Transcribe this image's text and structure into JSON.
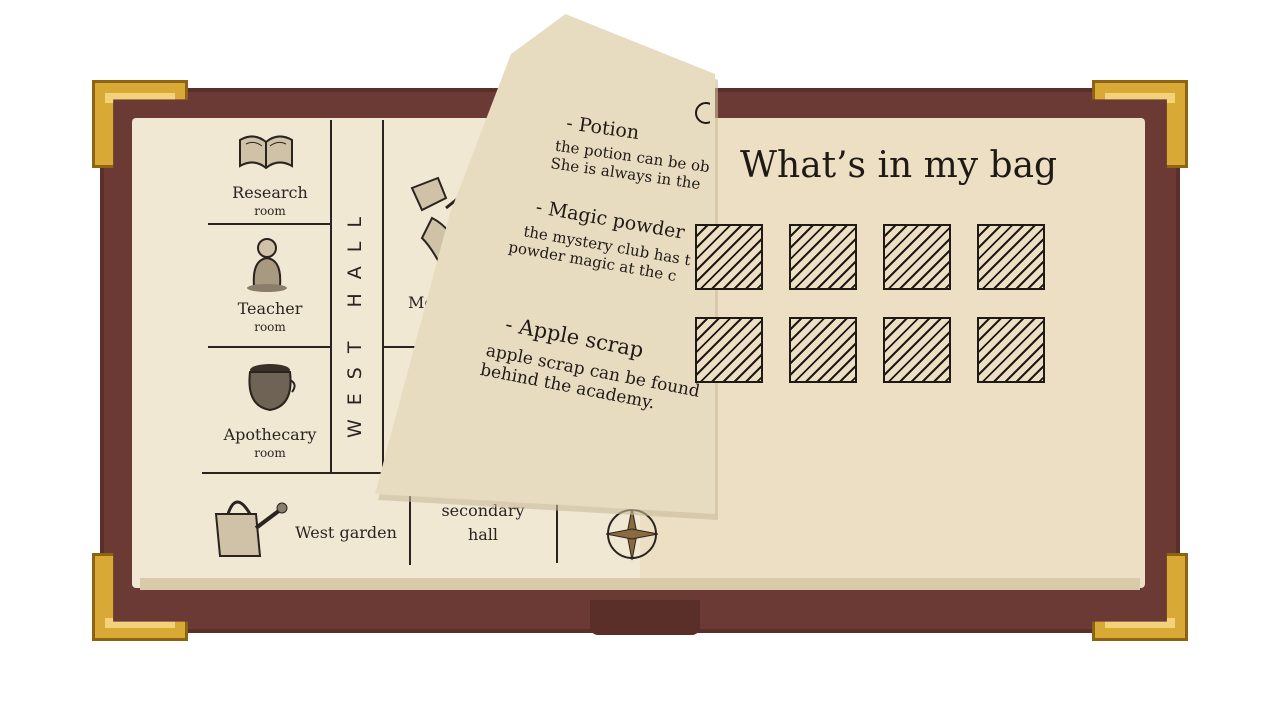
{
  "map": {
    "rooms": [
      {
        "name": "Research",
        "sub": "room"
      },
      {
        "name": "Teacher",
        "sub": "room"
      },
      {
        "name": "Apothecary",
        "sub": "room"
      }
    ],
    "hall_label": "WEST HALL",
    "meeting_label": "Mee",
    "west_garden": "West garden",
    "secondary_hall": [
      "secondary",
      "hall"
    ]
  },
  "note": {
    "entries": [
      {
        "title": "- Potion",
        "lines": [
          "the potion can be obt",
          "She is always in the"
        ]
      },
      {
        "title": "- Magic powder",
        "lines": [
          "the mystery club has t",
          "powder magic at the c"
        ]
      },
      {
        "title": "- Apple scrap",
        "lines": [
          "apple scrap can be found",
          "behind the academy."
        ]
      }
    ]
  },
  "bag": {
    "title": "What’s in my bag",
    "slots": [
      "empty",
      "empty",
      "empty",
      "empty",
      "empty",
      "empty",
      "empty",
      "empty"
    ]
  },
  "colors": {
    "cover": "#6b3a34",
    "page_left": "#f1e8d4",
    "page_right": "#ecdfc3",
    "corner_gold": "#d9a935",
    "ink": "#1f1a16"
  }
}
